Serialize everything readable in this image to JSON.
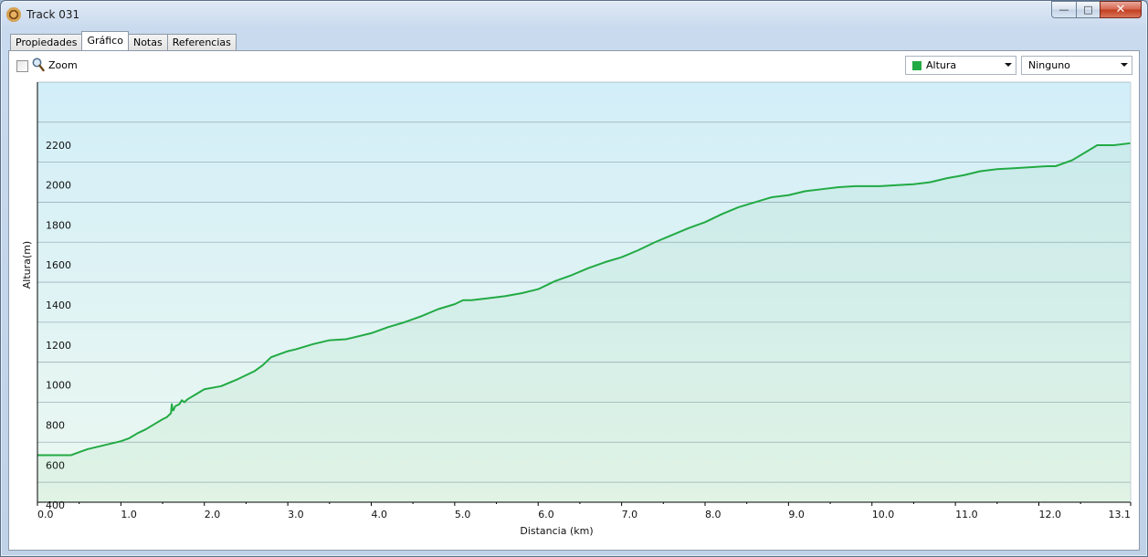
{
  "window": {
    "title": "Track 031",
    "title_icon": "track-icon",
    "buttons": {
      "minimize": "—",
      "maximize": "□",
      "close": "✕"
    }
  },
  "tabs": [
    {
      "label": "Propiedades",
      "active": false
    },
    {
      "label": "Gráfico",
      "active": true
    },
    {
      "label": "Notas",
      "active": false
    },
    {
      "label": "Referencias",
      "active": false
    }
  ],
  "toolbar": {
    "zoom_label": "Zoom",
    "zoom_checked": false,
    "series_select": {
      "value": "Altura",
      "color": "#22aa44"
    },
    "second_select": {
      "value": "Ninguno"
    }
  },
  "chart_data": {
    "type": "area",
    "xlabel": "Distancia  (km)",
    "ylabel": "Altura(m)",
    "xlim": [
      0,
      13.1
    ],
    "ylim": [
      300,
      2400
    ],
    "xticks": [
      "0.0",
      "1.0",
      "2.0",
      "3.0",
      "4.0",
      "5.0",
      "6.0",
      "7.0",
      "8.0",
      "9.0",
      "10.0",
      "11.0",
      "12.0",
      "13.1"
    ],
    "yticks": [
      "400",
      "600",
      "800",
      "1000",
      "1200",
      "1400",
      "1600",
      "1800",
      "2000",
      "2200"
    ],
    "grid": true,
    "colors": {
      "line": "#22aa44",
      "fill_top": "#d2eef8",
      "fill_bottom": "#ecf8f0",
      "grid": "#9fb0bd"
    },
    "series": [
      {
        "name": "Altura",
        "x": [
          0.0,
          0.4,
          0.5,
          0.6,
          0.8,
          1.0,
          1.1,
          1.2,
          1.3,
          1.4,
          1.5,
          1.55,
          1.6,
          1.61,
          1.62,
          1.63,
          1.65,
          1.7,
          1.73,
          1.76,
          1.8,
          1.9,
          2.0,
          2.2,
          2.4,
          2.6,
          2.7,
          2.8,
          3.0,
          3.1,
          3.3,
          3.5,
          3.7,
          3.8,
          4.0,
          4.2,
          4.4,
          4.6,
          4.8,
          5.0,
          5.1,
          5.2,
          5.4,
          5.6,
          5.8,
          6.0,
          6.2,
          6.4,
          6.6,
          6.8,
          7.0,
          7.2,
          7.4,
          7.6,
          7.8,
          8.0,
          8.2,
          8.4,
          8.6,
          8.8,
          9.0,
          9.2,
          9.4,
          9.6,
          9.8,
          10.0,
          10.1,
          10.3,
          10.5,
          10.7,
          10.9,
          11.1,
          11.3,
          11.5,
          11.7,
          11.9,
          12.1,
          12.2,
          12.4,
          12.6,
          12.7,
          12.9,
          13.1
        ],
        "values": [
          535,
          535,
          550,
          565,
          585,
          605,
          620,
          645,
          665,
          690,
          715,
          725,
          745,
          790,
          760,
          760,
          780,
          790,
          810,
          800,
          815,
          840,
          865,
          880,
          915,
          955,
          985,
          1025,
          1055,
          1065,
          1090,
          1110,
          1115,
          1125,
          1145,
          1175,
          1200,
          1230,
          1265,
          1290,
          1310,
          1310,
          1320,
          1330,
          1345,
          1365,
          1405,
          1435,
          1470,
          1500,
          1525,
          1560,
          1600,
          1635,
          1670,
          1700,
          1740,
          1775,
          1800,
          1825,
          1835,
          1855,
          1865,
          1875,
          1880,
          1880,
          1880,
          1885,
          1890,
          1900,
          1920,
          1935,
          1955,
          1965,
          1970,
          1975,
          1980,
          1980,
          2010,
          2060,
          2085,
          2085,
          2095
        ]
      }
    ]
  }
}
